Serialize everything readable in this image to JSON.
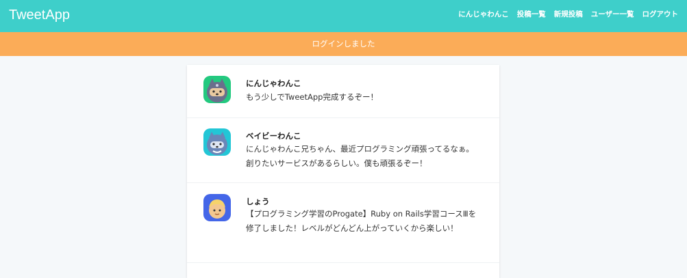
{
  "header": {
    "logo": "TweetApp",
    "nav": [
      "にんじゃわんこ",
      "投稿一覧",
      "新規投稿",
      "ユーザー一覧",
      "ログアウト"
    ]
  },
  "flash": {
    "message": "ログインしました"
  },
  "posts": [
    {
      "user": "にんじゃわんこ",
      "content": "もう少しでTweetApp完成するぞー！",
      "avatar": "ninja-dog-avatar"
    },
    {
      "user": "ベイビーわんこ",
      "content": "にんじゃわんこ兄ちゃん、最近プログラミング頑張ってるなぁ。創りたいサービスがあるらしい。僕も頑張るぞー！",
      "avatar": "baby-dog-avatar"
    },
    {
      "user": "しょう",
      "content": "【プログラミング学習のProgate】Ruby on Rails学習コースⅢを修了しました！レベルがどんどん上がっていくから楽しい！",
      "avatar": "boy-avatar"
    }
  ],
  "colors": {
    "header": "#3ecfca",
    "flash": "#fbac58",
    "background": "#f5f8fa"
  }
}
